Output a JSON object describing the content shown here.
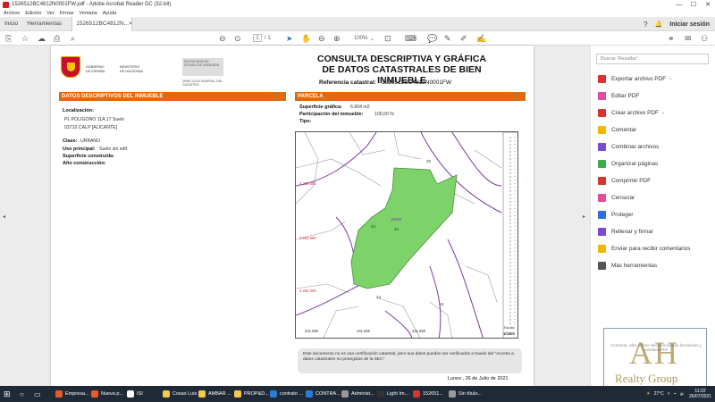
{
  "window": {
    "title": "1526512BC4812N0001FW.pdf - Adobe Acrobat Reader DC (32-bit)",
    "controls": [
      "—",
      "☐",
      "✕"
    ]
  },
  "menu": [
    "Archivo",
    "Edición",
    "Ver",
    "Firmar",
    "Ventana",
    "Ayuda"
  ],
  "tabs": {
    "home": "Inicio",
    "tools": "Herramientas",
    "doc": "1526512BC4812N...",
    "doc_close": "×",
    "signin": "Iniciar sesión"
  },
  "toolbar": {
    "page_current": "1",
    "page_total": "/ 1",
    "zoom": "100%"
  },
  "document": {
    "gov": [
      "GOBIERNO",
      "DE ESPAÑA"
    ],
    "ministry": [
      "MINISTERIO",
      "DE HACIENDA"
    ],
    "secretaria": "SECRETARÍA DE ESTADO DE HACIENDA",
    "direccion": "DIRECCIÓN GENERAL DEL CATASTRO",
    "title_line1": "CONSULTA DESCRIPTIVA Y GRÁFICA",
    "title_line2": "DE DATOS CATASTRALES DE BIEN INMUEBLE",
    "ref_label": "Referencia catastral:",
    "ref_value": "1526512BC4812N0001FW",
    "left_section": "DATOS DESCRIPTIVOS DEL INMUEBLE",
    "right_section": "PARCELA",
    "localizacion_label": "Localización:",
    "localizacion_line1": "PL POLIGONO 11A 17 Suelo",
    "localizacion_line2": "03710 CALP [ALICANTE]",
    "clase_label": "Clase:",
    "clase_value": "URBANO",
    "uso_label": "Uso principal:",
    "uso_value": "Suelo sin edif.",
    "superficie_c_label": "Superficie construida:",
    "anio_label": "Año construcción:",
    "superficie_g_label": "Superficie gráfica:",
    "superficie_g_value": "6.604 m2",
    "participacion_label": "Participación del inmueble:",
    "participacion_value": "100,00 %",
    "tipo_label": "Tipo:",
    "map": {
      "coords": [
        "4.282.680",
        "4.282.550",
        "4.282.000",
        "241.550",
        "241.650",
        "241.650"
      ],
      "parcel_labels": [
        "15295",
        "10",
        "63",
        "20",
        "18",
        "14"
      ],
      "scale_label": "Escala:",
      "scale_value": "1/1500"
    },
    "note": "Este documento no es una certificación catastral, pero sus datos pueden ser verificados a través del \"Acceso a datos catastrales no protegidos de la SEC\"",
    "date": "Lunes , 26 de Julio de 2021"
  },
  "right_pane": {
    "search_placeholder": "Buscar 'Resaltar'",
    "tools": [
      {
        "label": "Exportar archivo PDF",
        "color": "#d9342b",
        "caret": "⌄"
      },
      {
        "label": "Editar PDF",
        "color": "#e04d9b"
      },
      {
        "label": "Crear archivo PDF",
        "color": "#d9342b",
        "caret": "⌄"
      },
      {
        "label": "Comentar",
        "color": "#f2b800"
      },
      {
        "label": "Combinar archivos",
        "color": "#7a4bd0"
      },
      {
        "label": "Organizar páginas",
        "color": "#3dab4a"
      },
      {
        "label": "Comprimir PDF",
        "color": "#d9342b"
      },
      {
        "label": "Censurar",
        "color": "#e04d9b"
      },
      {
        "label": "Proteger",
        "color": "#2f6fd6"
      },
      {
        "label": "Rellenar y firmar",
        "color": "#7a4bd0"
      },
      {
        "label": "Enviar para recibir comentarios",
        "color": "#f2b800"
      },
      {
        "label": "Más herramientas",
        "color": "#555555"
      }
    ]
  },
  "watermark": {
    "letters": "AH",
    "name": "Realty Group",
    "text": "Convierta, edite y firme electrónicamente formularios y contratos PDF"
  },
  "taskbar": {
    "items": [
      {
        "label": "Empresa...",
        "color": "#e55b2c"
      },
      {
        "label": "Nueva p...",
        "color": "#e55b2c"
      },
      {
        "label": "ISI",
        "color": "#ffffff"
      },
      {
        "label": "Cosas Luis",
        "color": "#f2c94c"
      },
      {
        "label": "AMBAR ...",
        "color": "#f2c94c"
      },
      {
        "label": "PROP&D...",
        "color": "#f2c94c"
      },
      {
        "label": "contrato ...",
        "color": "#2b7cd3"
      },
      {
        "label": "CONTRA...",
        "color": "#2b7cd3"
      },
      {
        "label": "Administ...",
        "color": "#999999"
      },
      {
        "label": "Light Im...",
        "color": "#333333"
      },
      {
        "label": "152651...",
        "color": "#d9342b"
      },
      {
        "label": "Sin título...",
        "color": "#999999"
      }
    ],
    "weather": "27°C",
    "time": "11:22",
    "date": "26/07/2021"
  }
}
